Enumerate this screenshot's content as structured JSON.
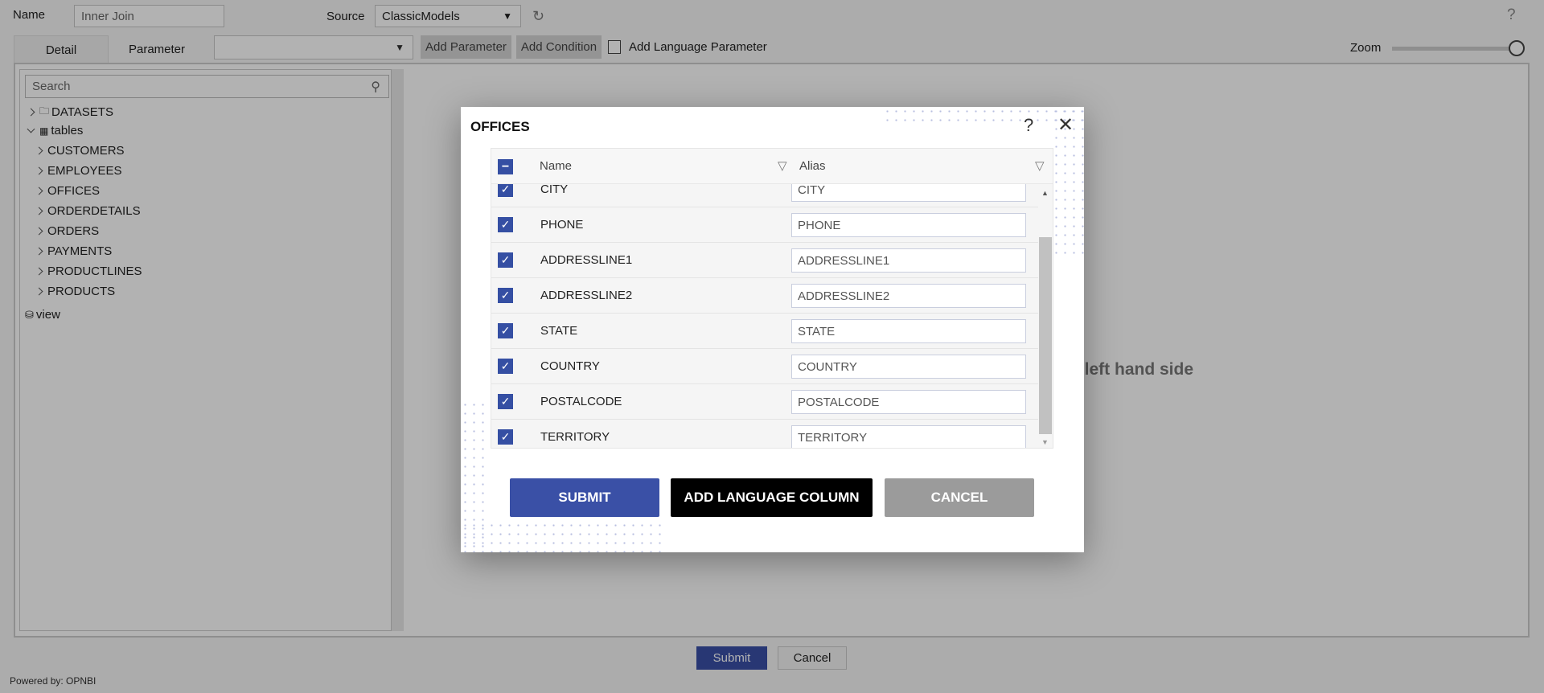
{
  "header": {
    "name_label": "Name",
    "name_value": "Inner Join",
    "source_label": "Source",
    "source_value": "ClassicModels",
    "help": "?"
  },
  "toolbar": {
    "tabs": [
      {
        "label": "Detail"
      },
      {
        "label": "Parameter"
      }
    ],
    "parameter_select": "",
    "add_parameter": "Add Parameter",
    "add_condition": "Add Condition",
    "add_language_parameter": "Add Language Parameter",
    "add_language_parameter_checked": false,
    "zoom_label": "Zoom",
    "zoom_level": 100
  },
  "sidebar": {
    "search_placeholder": "Search",
    "items": [
      {
        "label": "DATASETS",
        "icon": "folder-icon",
        "expanded": false
      },
      {
        "label": "tables",
        "icon": "table-icon",
        "expanded": true,
        "children": [
          "CUSTOMERS",
          "EMPLOYEES",
          "OFFICES",
          "ORDERDETAILS",
          "ORDERS",
          "PAYMENTS",
          "PRODUCTLINES",
          "PRODUCTS"
        ]
      },
      {
        "label": "view",
        "icon": "database-icon"
      }
    ]
  },
  "main": {
    "placeholder_text": "n left hand side"
  },
  "modal": {
    "title": "OFFICES",
    "help": "?",
    "columns": {
      "name": "Name",
      "alias": "Alias"
    },
    "rows": [
      {
        "name": "CITY",
        "alias": "CITY",
        "checked": true
      },
      {
        "name": "PHONE",
        "alias": "PHONE",
        "checked": true
      },
      {
        "name": "ADDRESSLINE1",
        "alias": "ADDRESSLINE1",
        "checked": true
      },
      {
        "name": "ADDRESSLINE2",
        "alias": "ADDRESSLINE2",
        "checked": true
      },
      {
        "name": "STATE",
        "alias": "STATE",
        "checked": true
      },
      {
        "name": "COUNTRY",
        "alias": "COUNTRY",
        "checked": true
      },
      {
        "name": "POSTALCODE",
        "alias": "POSTALCODE",
        "checked": true
      },
      {
        "name": "TERRITORY",
        "alias": "TERRITORY",
        "checked": true
      }
    ],
    "submit": "SUBMIT",
    "add_language_column": "ADD LANGUAGE COLUMN",
    "cancel": "CANCEL"
  },
  "footer": {
    "submit": "Submit",
    "cancel": "Cancel",
    "powered_by": "Powered by: OPNBI"
  },
  "colors": {
    "primary": "#3a50a6",
    "black_button": "#000000",
    "cancel_button": "#9b9b9b"
  }
}
